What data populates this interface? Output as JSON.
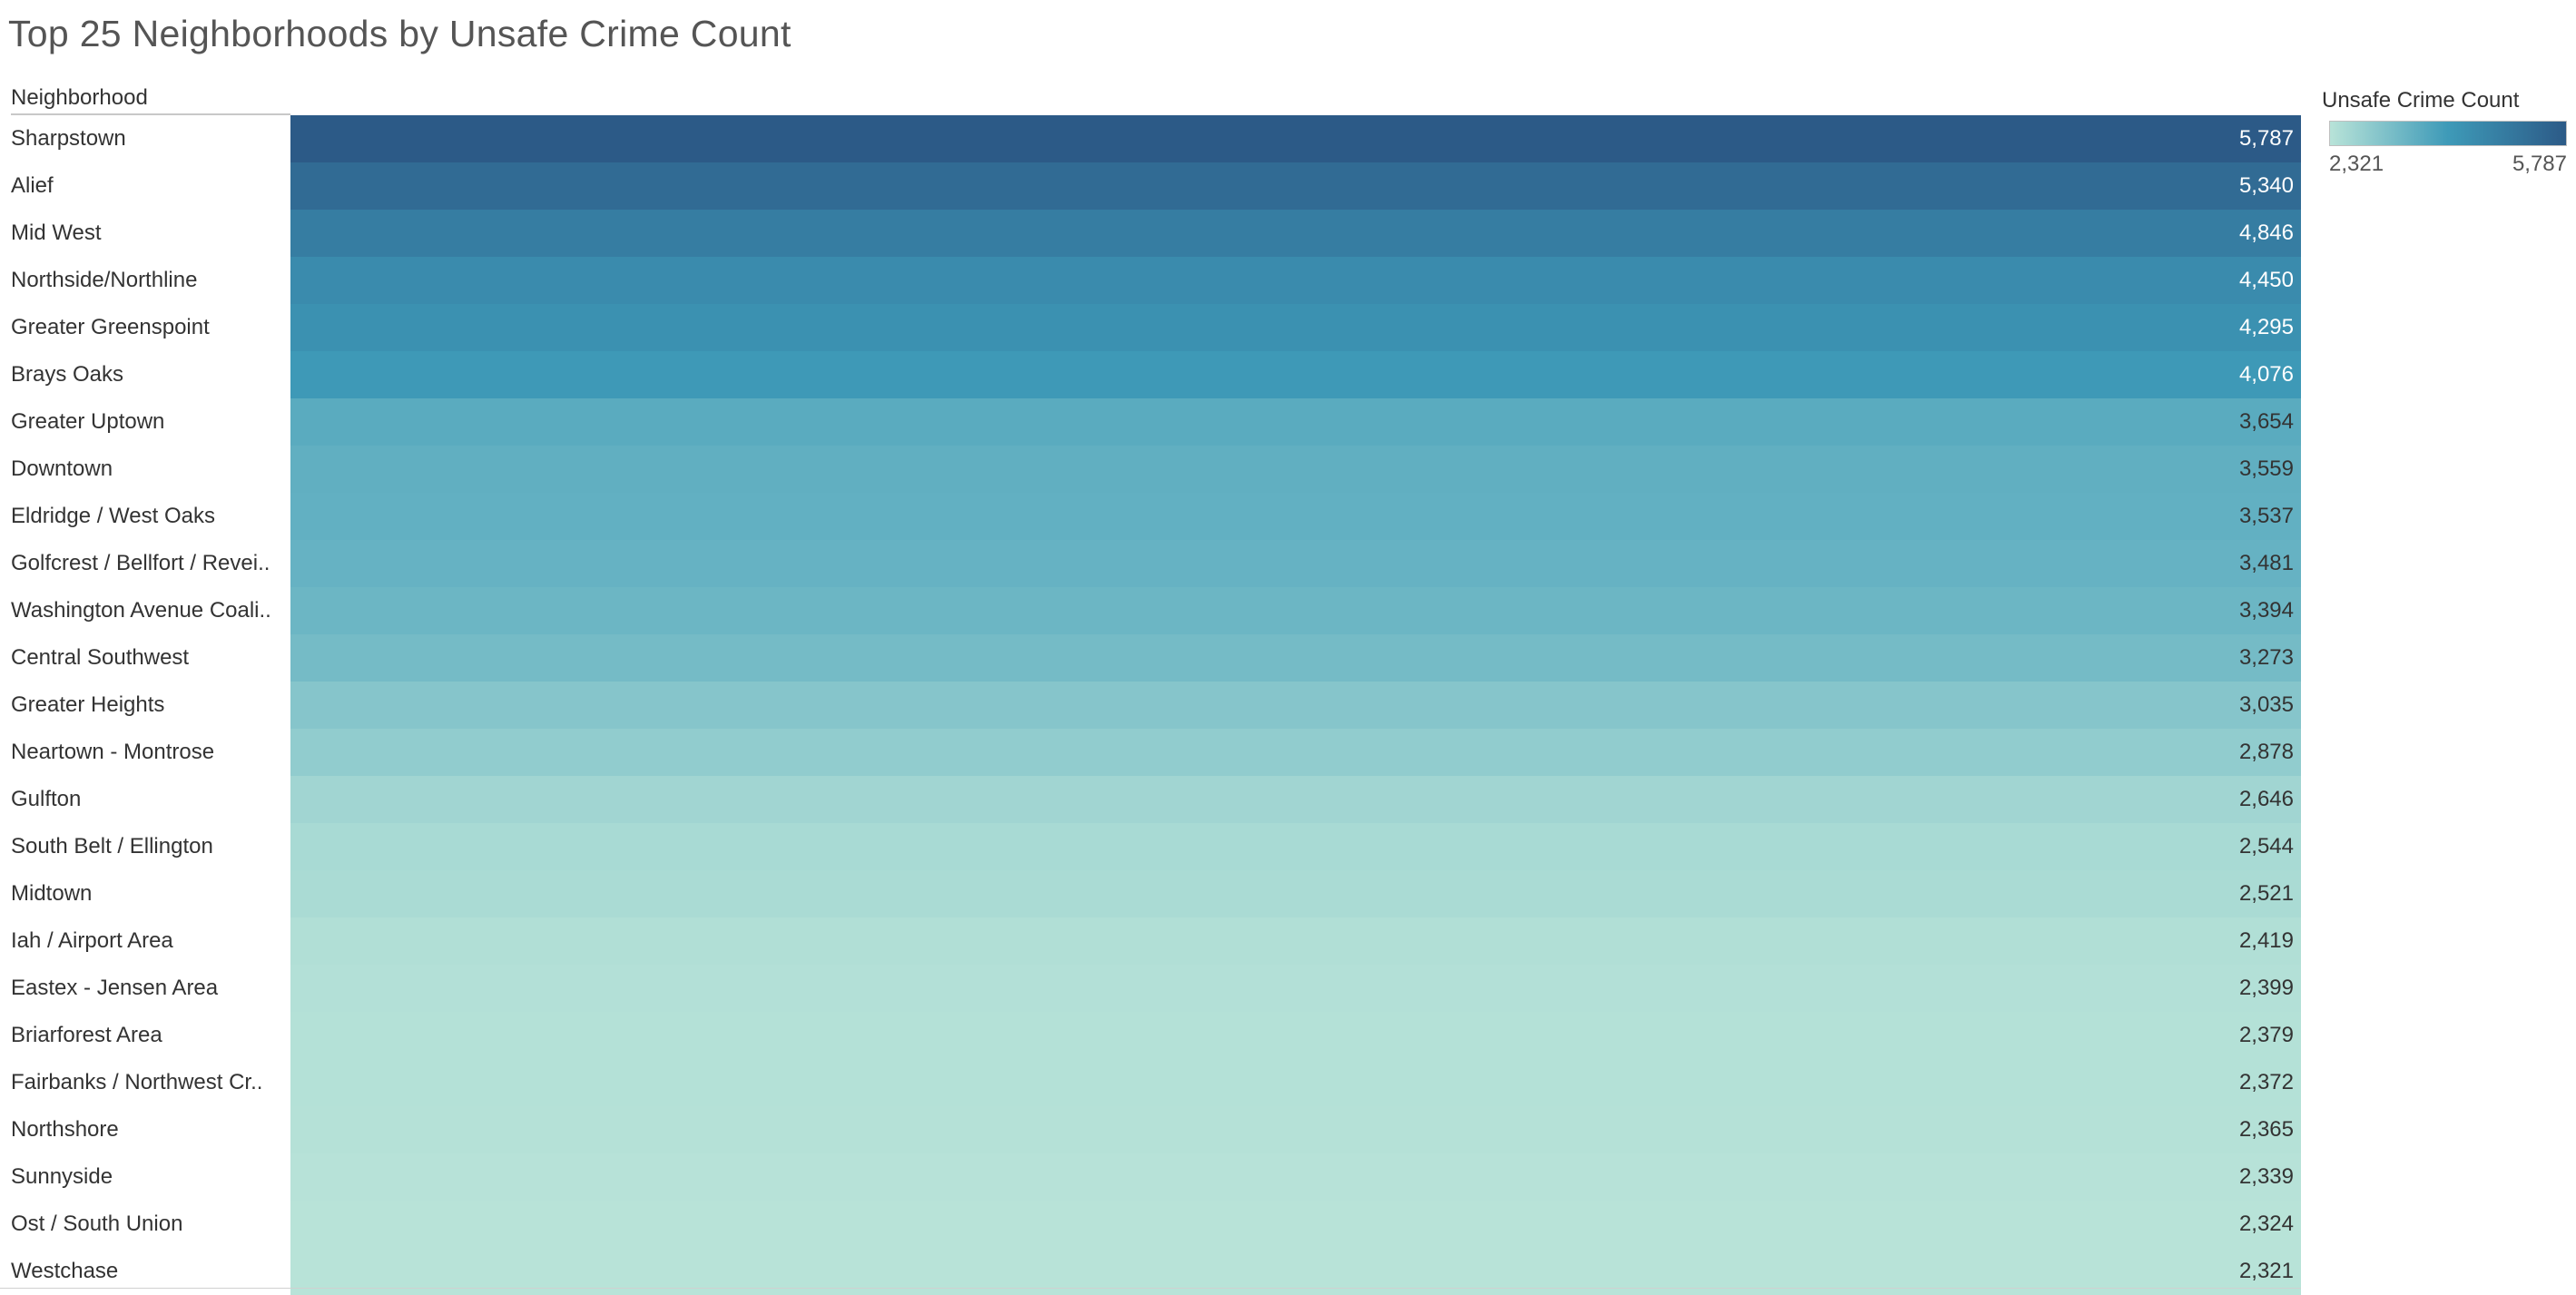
{
  "title": "Top 25 Neighborhoods by Unsafe Crime Count",
  "row_header": "Neighborhood",
  "legend": {
    "title": "Unsafe Crime Count",
    "min_label": "2,321",
    "max_label": "5,787",
    "color_low": "#b8e3d8",
    "color_mid": "#3e9ab8",
    "color_high": "#2c5a87"
  },
  "chart_data": {
    "type": "table",
    "title": "Top 25 Neighborhoods by Unsafe Crime Count",
    "row_header": "Neighborhood",
    "measure": "Unsafe Crime Count",
    "color_range": [
      2321,
      5787
    ],
    "rows": [
      {
        "label": "Sharpstown",
        "value": 5787,
        "display": "5,787"
      },
      {
        "label": "Alief",
        "value": 5340,
        "display": "5,340"
      },
      {
        "label": "Mid West",
        "value": 4846,
        "display": "4,846"
      },
      {
        "label": "Northside/Northline",
        "value": 4450,
        "display": "4,450"
      },
      {
        "label": "Greater Greenspoint",
        "value": 4295,
        "display": "4,295"
      },
      {
        "label": "Brays Oaks",
        "value": 4076,
        "display": "4,076"
      },
      {
        "label": "Greater Uptown",
        "value": 3654,
        "display": "3,654"
      },
      {
        "label": "Downtown",
        "value": 3559,
        "display": "3,559"
      },
      {
        "label": "Eldridge / West Oaks",
        "value": 3537,
        "display": "3,537"
      },
      {
        "label": "Golfcrest / Bellfort / Revei..",
        "value": 3481,
        "display": "3,481"
      },
      {
        "label": "Washington Avenue Coali..",
        "value": 3394,
        "display": "3,394"
      },
      {
        "label": "Central Southwest",
        "value": 3273,
        "display": "3,273"
      },
      {
        "label": "Greater Heights",
        "value": 3035,
        "display": "3,035"
      },
      {
        "label": "Neartown - Montrose",
        "value": 2878,
        "display": "2,878"
      },
      {
        "label": "Gulfton",
        "value": 2646,
        "display": "2,646"
      },
      {
        "label": "South Belt / Ellington",
        "value": 2544,
        "display": "2,544"
      },
      {
        "label": "Midtown",
        "value": 2521,
        "display": "2,521"
      },
      {
        "label": "Iah / Airport Area",
        "value": 2419,
        "display": "2,419"
      },
      {
        "label": "Eastex - Jensen Area",
        "value": 2399,
        "display": "2,399"
      },
      {
        "label": "Briarforest Area",
        "value": 2379,
        "display": "2,379"
      },
      {
        "label": "Fairbanks / Northwest Cr..",
        "value": 2372,
        "display": "2,372"
      },
      {
        "label": "Northshore",
        "value": 2365,
        "display": "2,365"
      },
      {
        "label": "Sunnyside",
        "value": 2339,
        "display": "2,339"
      },
      {
        "label": "Ost / South Union",
        "value": 2324,
        "display": "2,324"
      },
      {
        "label": "Westchase",
        "value": 2321,
        "display": "2,321"
      }
    ]
  }
}
